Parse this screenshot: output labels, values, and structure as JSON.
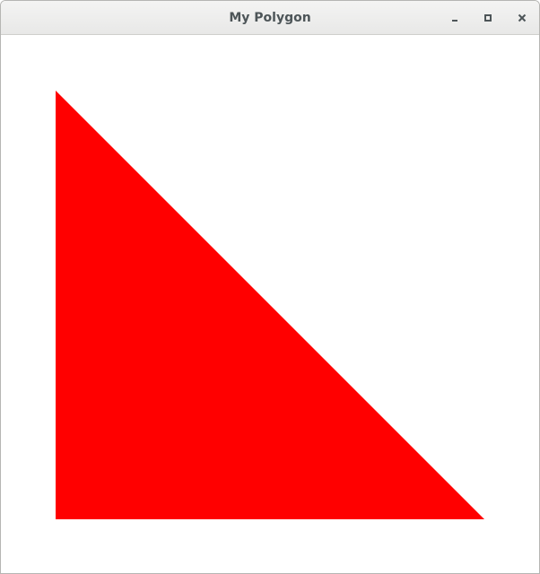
{
  "window": {
    "title": "My Polygon"
  },
  "controls": {
    "minimize_icon": "minimize-icon",
    "maximize_icon": "maximize-icon",
    "close_icon": "close-icon"
  },
  "polygon": {
    "shape": "right-triangle",
    "fill": "#ff0000"
  }
}
